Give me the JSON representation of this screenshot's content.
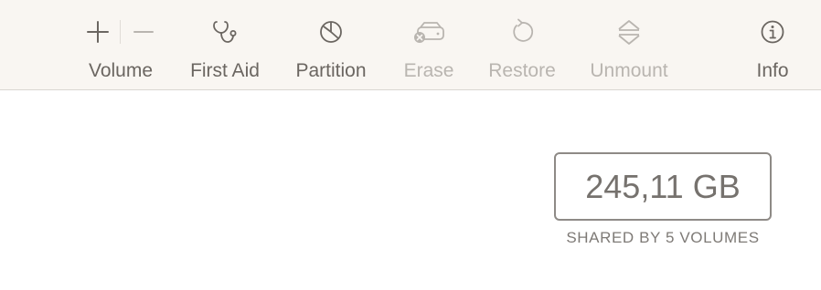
{
  "toolbar": {
    "volume": {
      "label": "Volume",
      "plus_icon": "plus-icon",
      "minus_icon": "minus-icon"
    },
    "items": [
      {
        "label": "First Aid",
        "icon": "stethoscope-icon",
        "enabled": true
      },
      {
        "label": "Partition",
        "icon": "pie-chart-icon",
        "enabled": true
      },
      {
        "label": "Erase",
        "icon": "erase-disk-icon",
        "enabled": false
      },
      {
        "label": "Restore",
        "icon": "restore-icon",
        "enabled": false
      },
      {
        "label": "Unmount",
        "icon": "eject-icon",
        "enabled": false
      },
      {
        "label": "Info",
        "icon": "info-icon",
        "enabled": true
      }
    ]
  },
  "capacity": {
    "value": "245,11 GB",
    "subtitle": "SHARED BY 5 VOLUMES"
  },
  "colors": {
    "toolbar_bg": "#f9f6f2",
    "icon_enabled": "#6b6661",
    "icon_disabled": "#b9b5b0"
  }
}
